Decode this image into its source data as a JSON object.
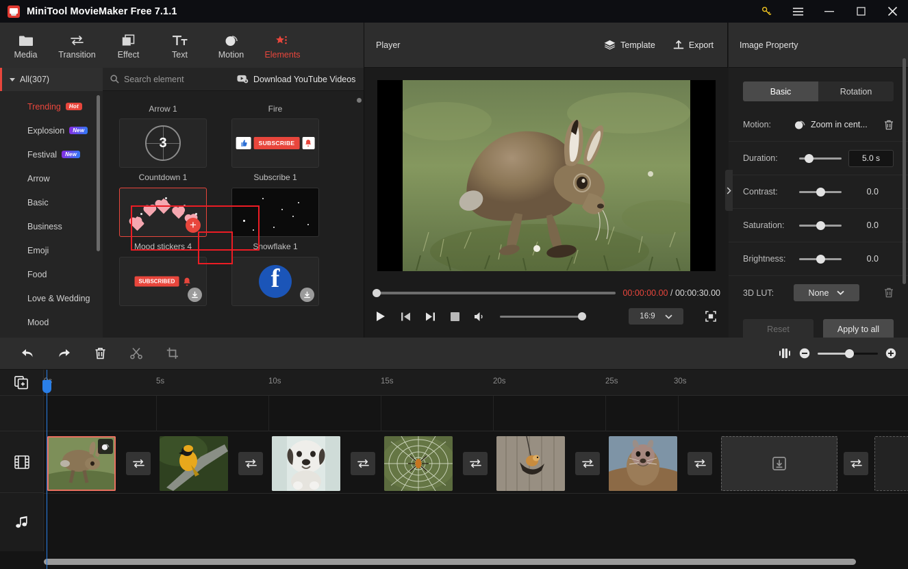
{
  "titlebar": {
    "app_title": "MiniTool MovieMaker Free 7.1.1",
    "key_icon": "key-icon",
    "menu_icon": "hamburger-menu-icon",
    "minimize": "minimize-icon",
    "maximize": "maximize-icon",
    "close": "close-icon"
  },
  "toolbar": {
    "tabs": [
      {
        "label": "Media",
        "icon": "folder-icon",
        "active": false
      },
      {
        "label": "Transition",
        "icon": "transition-icon",
        "active": false
      },
      {
        "label": "Effect",
        "icon": "effect-icon",
        "active": false
      },
      {
        "label": "Text",
        "icon": "text-icon",
        "active": false
      },
      {
        "label": "Motion",
        "icon": "motion-icon",
        "active": false
      },
      {
        "label": "Elements",
        "icon": "elements-icon",
        "active": true
      }
    ],
    "accent_color": "#e8463c"
  },
  "categories": {
    "all_label": "All(307)",
    "items": [
      {
        "label": "Trending",
        "badge": "Hot",
        "badge_type": "hot",
        "highlight": true
      },
      {
        "label": "Explosion",
        "badge": "New",
        "badge_type": "new",
        "highlight": false
      },
      {
        "label": "Festival",
        "badge": "New",
        "badge_type": "new",
        "highlight": false
      },
      {
        "label": "Arrow",
        "badge": "",
        "badge_type": "",
        "highlight": false
      },
      {
        "label": "Basic",
        "badge": "",
        "badge_type": "",
        "highlight": false
      },
      {
        "label": "Business",
        "badge": "",
        "badge_type": "",
        "highlight": false
      },
      {
        "label": "Emoji",
        "badge": "",
        "badge_type": "",
        "highlight": false
      },
      {
        "label": "Food",
        "badge": "",
        "badge_type": "",
        "highlight": false
      },
      {
        "label": "Love & Wedding",
        "badge": "",
        "badge_type": "",
        "highlight": false
      },
      {
        "label": "Mood",
        "badge": "",
        "badge_type": "",
        "highlight": false
      }
    ]
  },
  "browser": {
    "search_placeholder": "Search element",
    "youtube_label": "Download YouTube Videos",
    "youtube_icon": "youtube-download-icon",
    "top_titles": {
      "left": "Arrow 1",
      "right": "Fire"
    },
    "items": [
      {
        "caption": "Countdown 1",
        "kind": "countdown",
        "number": "3",
        "selected": false,
        "downloadable": false
      },
      {
        "caption": "Subscribe 1",
        "kind": "subscribe",
        "button_text": "SUBSCRIBE",
        "selected": false,
        "downloadable": false
      },
      {
        "caption": "Mood stickers 4",
        "kind": "hearts",
        "selected": true,
        "downloadable": false,
        "add_badge": "+"
      },
      {
        "caption": "Snowflake 1",
        "kind": "snow",
        "selected": false,
        "downloadable": false
      },
      {
        "caption": "",
        "kind": "subscribed",
        "button_text": "SUBSCRIBED",
        "selected": false,
        "downloadable": true
      },
      {
        "caption": "",
        "kind": "facebook",
        "glyph": "f",
        "selected": false,
        "downloadable": true
      }
    ]
  },
  "player": {
    "title": "Player",
    "template_label": "Template",
    "template_icon": "layers-icon",
    "export_label": "Export",
    "export_icon": "export-upload-icon",
    "current_time": "00:00:00.00",
    "separator": "/",
    "total_time": "00:00:30.00",
    "seek_percent": 0,
    "volume_percent": 100,
    "aspect_ratio": "16:9",
    "controls": [
      {
        "name": "play-button",
        "icon": "play-icon"
      },
      {
        "name": "prev-frame-button",
        "icon": "skip-back-icon"
      },
      {
        "name": "next-frame-button",
        "icon": "skip-forward-icon"
      },
      {
        "name": "stop-button",
        "icon": "stop-icon"
      },
      {
        "name": "volume-button",
        "icon": "speaker-icon"
      }
    ],
    "fullscreen_icon": "fullscreen-icon"
  },
  "properties": {
    "panel_title": "Image Property",
    "tabs": [
      {
        "label": "Basic",
        "active": true
      },
      {
        "label": "Rotation",
        "active": false
      }
    ],
    "rows": [
      {
        "label": "Motion:",
        "type": "motion",
        "value": "Zoom in cent...",
        "icon": "motion-icon",
        "delete_icon": "trash-icon"
      },
      {
        "label": "Duration:",
        "type": "slider-box",
        "value": "5.0 s",
        "slider_percent": 22
      },
      {
        "label": "Contrast:",
        "type": "slider",
        "value": "0.0",
        "slider_percent": 50
      },
      {
        "label": "Saturation:",
        "type": "slider",
        "value": "0.0",
        "slider_percent": 50
      },
      {
        "label": "Brightness:",
        "type": "slider",
        "value": "0.0",
        "slider_percent": 50
      },
      {
        "label": "3D LUT:",
        "type": "select",
        "value": "None",
        "delete_icon": "trash-icon"
      }
    ],
    "reset_label": "Reset",
    "apply_label": "Apply to all",
    "collapse_icon": "chevron-right-icon"
  },
  "timeline_toolbar": {
    "buttons": [
      {
        "name": "undo-button",
        "icon": "undo-icon",
        "enabled": true
      },
      {
        "name": "redo-button",
        "icon": "redo-icon",
        "enabled": true
      },
      {
        "name": "delete-button",
        "icon": "trash-icon",
        "enabled": true
      },
      {
        "name": "split-button",
        "icon": "scissors-icon",
        "enabled": false
      },
      {
        "name": "crop-button",
        "icon": "crop-icon",
        "enabled": false
      }
    ],
    "fit_icon": "fit-timeline-icon",
    "zoom_out_icon": "zoom-out-icon",
    "zoom_in_icon": "zoom-in-icon",
    "zoom_percent": 46
  },
  "timeline": {
    "add_media_icon": "add-media-icon",
    "video_track_icon": "film-strip-icon",
    "audio_track_icon": "music-note-icon",
    "ruler_ticks": [
      "0s",
      "5s",
      "10s",
      "15s",
      "20s",
      "25s",
      "30s"
    ],
    "playhead_time": "0s",
    "clips": [
      {
        "name": "hare",
        "selected": true,
        "has_motion_badge": true
      },
      {
        "name": "bird",
        "selected": false,
        "has_motion_badge": false
      },
      {
        "name": "dog",
        "selected": false,
        "has_motion_badge": false
      },
      {
        "name": "spider",
        "selected": false,
        "has_motion_badge": false
      },
      {
        "name": "feeder",
        "selected": false,
        "has_motion_badge": false
      },
      {
        "name": "squirrel",
        "selected": false,
        "has_motion_badge": false
      }
    ],
    "placeholder_icon": "download-placeholder-icon",
    "transition_icon": "transition-swap-icon",
    "transition_count": 7
  }
}
